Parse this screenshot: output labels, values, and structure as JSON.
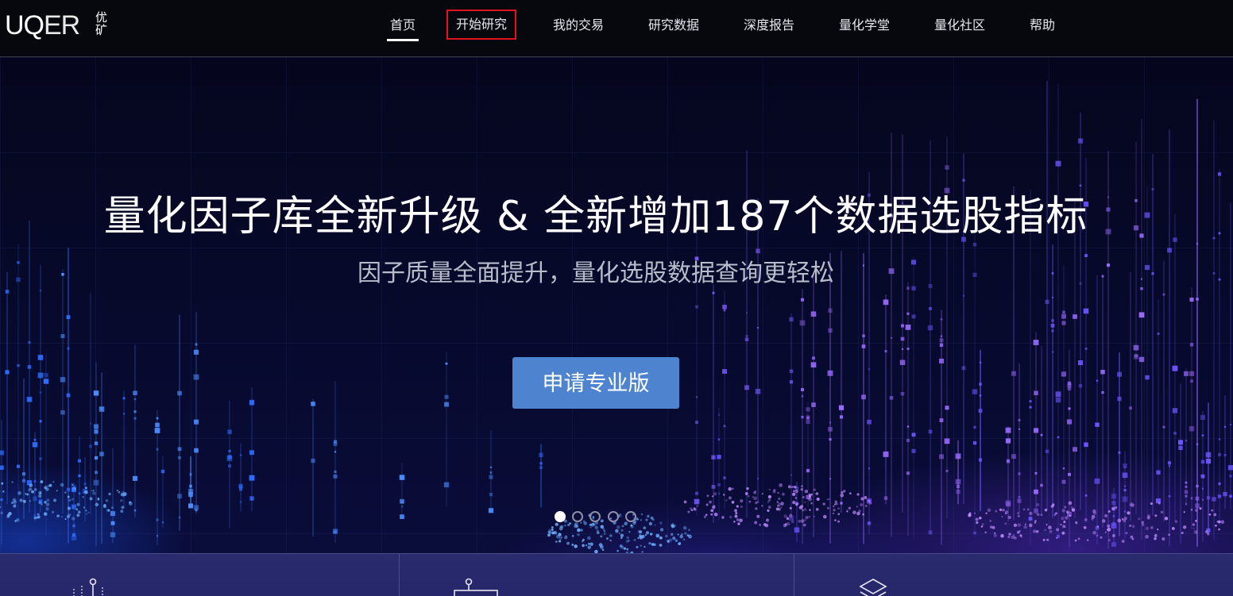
{
  "brand": {
    "logo_text_bold": "UQ",
    "logo_text_thin": "ER",
    "logo_cn": "优矿"
  },
  "nav": {
    "items": [
      {
        "label": "首页"
      },
      {
        "label": "开始研究"
      },
      {
        "label": "我的交易"
      },
      {
        "label": "研究数据"
      },
      {
        "label": "深度报告"
      },
      {
        "label": "量化学堂"
      },
      {
        "label": "量化社区"
      },
      {
        "label": "帮助"
      }
    ],
    "active_index": 0,
    "highlight_index": 1
  },
  "hero": {
    "title": "量化因子库全新升级 & 全新增加187个数据选股指标",
    "subtitle": "因子质量全面提升，量化选股数据查询更轻松",
    "cta_label": "申请专业版",
    "slides_total": 5,
    "slide_current": 1
  },
  "features": {
    "icons": [
      "chart-bars-icon",
      "dashboard-icon",
      "layers-icon"
    ]
  },
  "colors": {
    "accent": "#4e84cf",
    "highlight_border": "#e0141c",
    "header_bg": "#07070e",
    "hero_bg": "#05061d",
    "feature_strip": "#2a2a6e"
  }
}
